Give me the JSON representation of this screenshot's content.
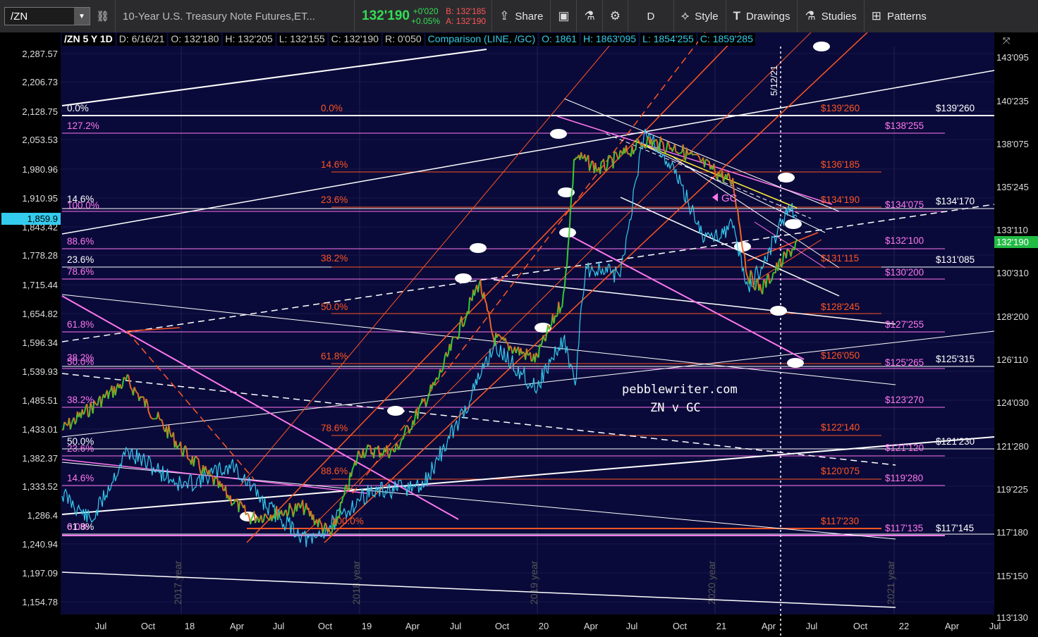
{
  "toolbar": {
    "symbol": "/ZN",
    "description": "10-Year U.S. Treasury Note Futures,ET...",
    "last_price": "132'190",
    "change_abs": "+0'020",
    "change_pct": "+0.05%",
    "bid": "B: 132'185",
    "ask": "A: 132'190",
    "share": "Share",
    "aggregation": "D",
    "style": "Style",
    "drawings": "Drawings",
    "studies": "Studies",
    "patterns": "Patterns"
  },
  "header": {
    "symbol": "/ZN 5 Y 1D",
    "date": "D: 6/16/21",
    "open": "O: 132'180",
    "high": "H: 132'205",
    "low": "L: 132'155",
    "close": "C: 132'190",
    "range": "R: 0'050",
    "comparison": "Comparison (LINE, /GC)",
    "c_open": "O: 1861",
    "c_high": "H: 1863'095",
    "c_low": "L: 1854'255",
    "c_close": "C: 1859'285"
  },
  "left_axis": [
    "2,287.57",
    "2,206.73",
    "2,128.75",
    "2,053.53",
    "1,980.96",
    "1,910.95",
    "1,843.42",
    "1,778.28",
    "1,715.44",
    "1,654.82",
    "1,596.34",
    "1,539.93",
    "1,485.51",
    "1,433.01",
    "1,382.37",
    "1,333.52",
    "1,286.4",
    "1,240.94",
    "1,197.09",
    "1,154.78"
  ],
  "left_current": "1,859.9",
  "right_axis": [
    "143'095",
    "140'235",
    "138'075",
    "135'245",
    "133'110",
    "130'310",
    "128'200",
    "126'110",
    "124'030",
    "121'280",
    "119'225",
    "117'180",
    "115'150",
    "113'130"
  ],
  "right_current": "132'190",
  "x_axis": [
    "Jul",
    "Oct",
    "18",
    "Apr",
    "Jul",
    "Oct",
    "19",
    "Apr",
    "Jul",
    "Oct",
    "20",
    "Apr",
    "Jul",
    "Oct",
    "21",
    "Apr",
    "Jul",
    "Oct",
    "22",
    "Apr",
    "Jul"
  ],
  "year_marks": [
    "2017 year",
    "2018 year",
    "2019 year",
    "2020 year",
    "2021 year"
  ],
  "vline_label": "5/12/21",
  "watermark": [
    "pebblewriter.com",
    "ZN v GC"
  ],
  "gc_label": "GC",
  "fib_left": [
    {
      "t": "0.0%",
      "c": "#ffffff"
    },
    {
      "t": "127.2%",
      "c": "#ff77ee"
    },
    {
      "t": "14.6%",
      "c": "#ffffff"
    },
    {
      "t": "100.0%",
      "c": "#ff77ee"
    },
    {
      "t": "88.6%",
      "c": "#ff77ee"
    },
    {
      "t": "23.6%",
      "c": "#ffffff"
    },
    {
      "t": "78.6%",
      "c": "#ff77ee"
    },
    {
      "t": "61.8%",
      "c": "#ff77ee"
    },
    {
      "t": "38.2%",
      "c": "#ff77ee"
    },
    {
      "t": "50.0%",
      "c": "#ff77ee"
    },
    {
      "t": "38.2%",
      "c": "#ff77ee"
    },
    {
      "t": "50.0%",
      "c": "#ffffff"
    },
    {
      "t": "23.6%",
      "c": "#ff77ee"
    },
    {
      "t": "14.6%",
      "c": "#ff77ee"
    },
    {
      "t": "61.8%",
      "c": "#ffffff"
    },
    {
      "t": "0.0%",
      "c": "#ff77ee"
    }
  ],
  "fib_mid": [
    {
      "t": "0.0%"
    },
    {
      "t": "14.6%"
    },
    {
      "t": "23.6%"
    },
    {
      "t": "38.2%"
    },
    {
      "t": "50.0%"
    },
    {
      "t": "61.8%"
    },
    {
      "t": "78.6%"
    },
    {
      "t": "88.6%"
    },
    {
      "t": "100.0%"
    }
  ],
  "price_levels": [
    {
      "t": "$139'260",
      "c": "#ff5522"
    },
    {
      "t": "$138'255",
      "c": "#ff77ee"
    },
    {
      "t": "$136'185",
      "c": "#ff5522"
    },
    {
      "t": "$134'190",
      "c": "#ff5522"
    },
    {
      "t": "$134'075",
      "c": "#ff77ee"
    },
    {
      "t": "$132'100",
      "c": "#ff77ee"
    },
    {
      "t": "$131'115",
      "c": "#ff5522"
    },
    {
      "t": "$130'200",
      "c": "#ff77ee"
    },
    {
      "t": "$128'245",
      "c": "#ff5522"
    },
    {
      "t": "$127'255",
      "c": "#ff77ee"
    },
    {
      "t": "$126'050",
      "c": "#ff5522"
    },
    {
      "t": "$125'265",
      "c": "#ff77ee"
    },
    {
      "t": "$123'270",
      "c": "#ff77ee"
    },
    {
      "t": "$122'140",
      "c": "#ff5522"
    },
    {
      "t": "$121'120",
      "c": "#ff77ee"
    },
    {
      "t": "$120'075",
      "c": "#ff5522"
    },
    {
      "t": "$119'280",
      "c": "#ff77ee"
    },
    {
      "t": "$117'230",
      "c": "#ff5522"
    },
    {
      "t": "$117'135",
      "c": "#ff77ee"
    }
  ],
  "white_levels": [
    "$139'260",
    "$134'170",
    "$131'085",
    "$125'315",
    "$121'230",
    "$117'145"
  ]
}
